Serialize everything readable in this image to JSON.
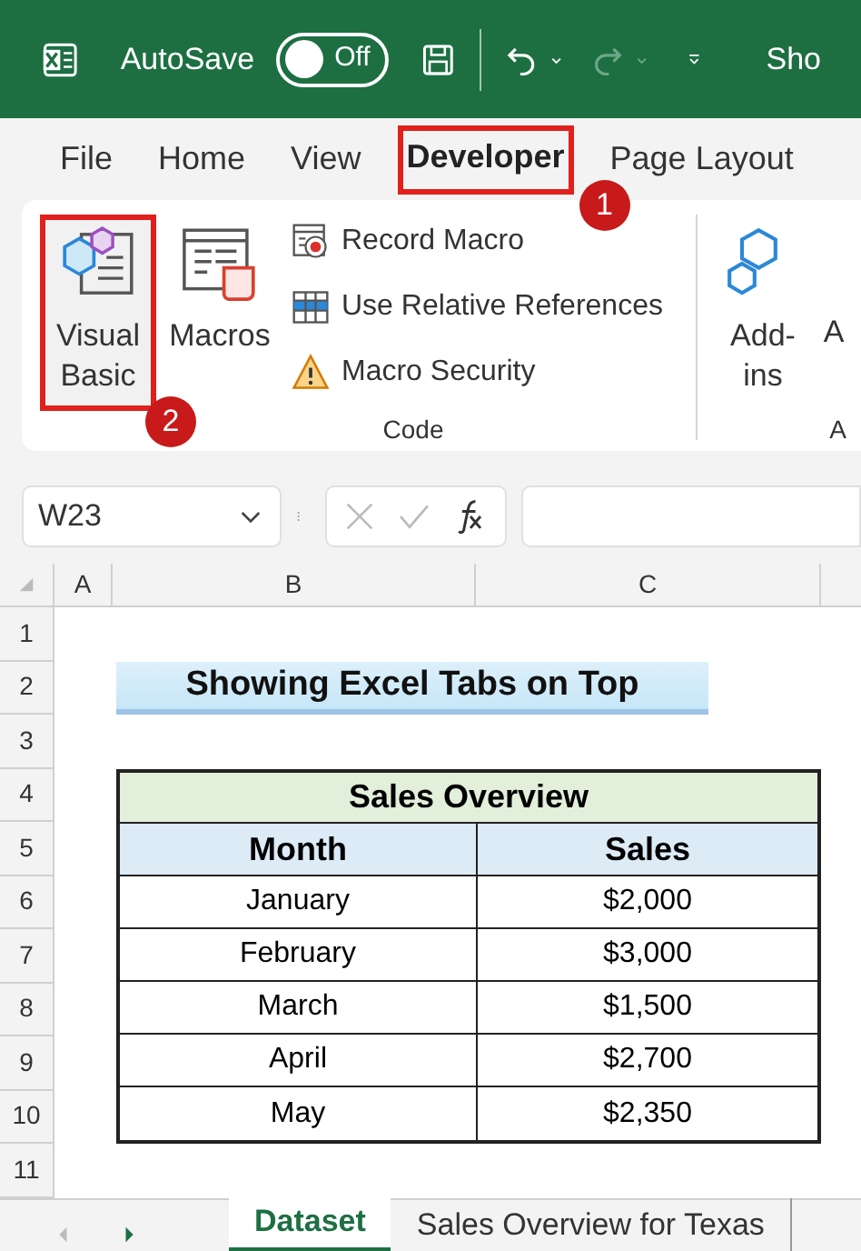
{
  "title_bar": {
    "autosave_label": "AutoSave",
    "autosave": {
      "on": false,
      "label": "Off"
    },
    "title": "Sho"
  },
  "ribbon_tabs": [
    {
      "label": "File",
      "selected": false
    },
    {
      "label": "Home",
      "selected": false
    },
    {
      "label": "View",
      "selected": false
    },
    {
      "label": "Developer",
      "selected": true,
      "callout": "1"
    },
    {
      "label": "Page Layout",
      "selected": false
    }
  ],
  "ribbon": {
    "code_group": {
      "label": "Code",
      "large_buttons": [
        {
          "kind": "visual-basic",
          "label": "Visual Basic",
          "callout": "2"
        },
        {
          "kind": "macros",
          "label": "Macros"
        }
      ],
      "small_buttons": [
        {
          "kind": "record",
          "label": "Record Macro"
        },
        {
          "kind": "relative",
          "label": "Use Relative References"
        },
        {
          "kind": "security",
          "label": "Macro Security"
        }
      ]
    },
    "addins_group": {
      "buttons": [
        {
          "kind": "addins",
          "label": "Add-ins"
        },
        {
          "kind": "partial",
          "label": "A"
        }
      ],
      "label": "A"
    }
  },
  "formula_bar": {
    "name_box": "W23"
  },
  "sheet": {
    "columns": [
      "A",
      "B",
      "C"
    ],
    "row_numbers": [
      "1",
      "2",
      "3",
      "4",
      "5",
      "6",
      "7",
      "8",
      "9",
      "10",
      "11"
    ],
    "banner": "Showing Excel Tabs on Top",
    "table": {
      "caption": "Sales Overview",
      "columns": [
        "Month",
        "Sales"
      ],
      "rows": [
        [
          "January",
          "$2,000"
        ],
        [
          "February",
          "$3,000"
        ],
        [
          "March",
          "$1,500"
        ],
        [
          "April",
          "$2,700"
        ],
        [
          "May",
          "$2,350"
        ]
      ]
    }
  },
  "sheet_tabs": [
    {
      "label": "Dataset",
      "selected": true
    },
    {
      "label": "Sales Overview for Texas",
      "selected": false
    }
  ]
}
